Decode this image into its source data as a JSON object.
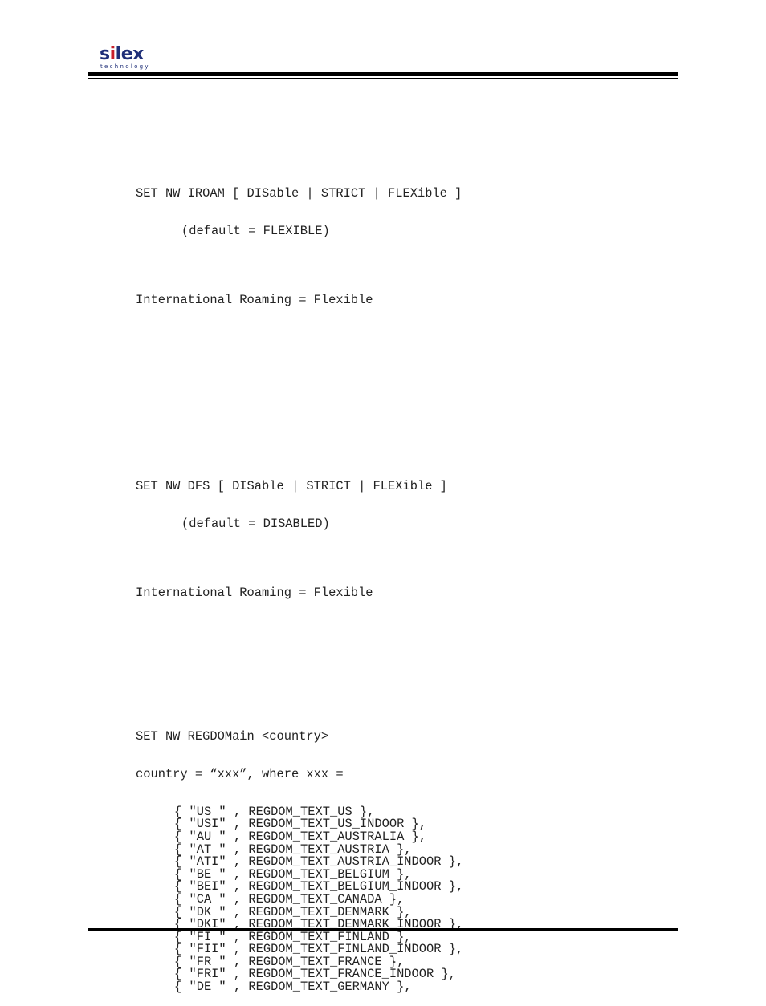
{
  "header": {
    "logo": {
      "brand": "silex",
      "tagline": "technology",
      "brand_color": "#1f2f78",
      "accent_color": "#c8202a"
    }
  },
  "sections": {
    "iroam": {
      "command": "SET NW IROAM [ DISable | STRICT | FLEXible ]",
      "default": "(default = FLEXIBLE)",
      "example_output": "International Roaming = Flexible"
    },
    "dfs": {
      "command": "SET NW DFS [ DISable | STRICT | FLEXible ]",
      "default": "(default = DISABLED)",
      "example_output": "International Roaming = Flexible"
    },
    "regdomain": {
      "command": "SET NW REGDOMain <country>",
      "country_line": "country = “xxx”, where xxx =",
      "entries": [
        "{ \"US \" , REGDOM_TEXT_US },",
        "{ \"USI\" , REGDOM_TEXT_US_INDOOR },",
        "{ \"AU \" , REGDOM_TEXT_AUSTRALIA },",
        "{ \"AT \" , REGDOM_TEXT_AUSTRIA },",
        "{ \"ATI\" , REGDOM_TEXT_AUSTRIA_INDOOR },",
        "{ \"BE \" , REGDOM_TEXT_BELGIUM },",
        "{ \"BEI\" , REGDOM_TEXT_BELGIUM_INDOOR },",
        "{ \"CA \" , REGDOM_TEXT_CANADA },",
        "{ \"DK \" , REGDOM_TEXT_DENMARK },",
        "{ \"DKI\" , REGDOM_TEXT_DENMARK_INDOOR },",
        "{ \"FI \" , REGDOM_TEXT_FINLAND },",
        "{ \"FII\" , REGDOM_TEXT_FINLAND_INDOOR },",
        "{ \"FR \" , REGDOM_TEXT_FRANCE },",
        "{ \"FRI\" , REGDOM_TEXT_FRANCE_INDOOR },",
        "{ \"DE \" , REGDOM_TEXT_GERMANY },"
      ]
    }
  }
}
